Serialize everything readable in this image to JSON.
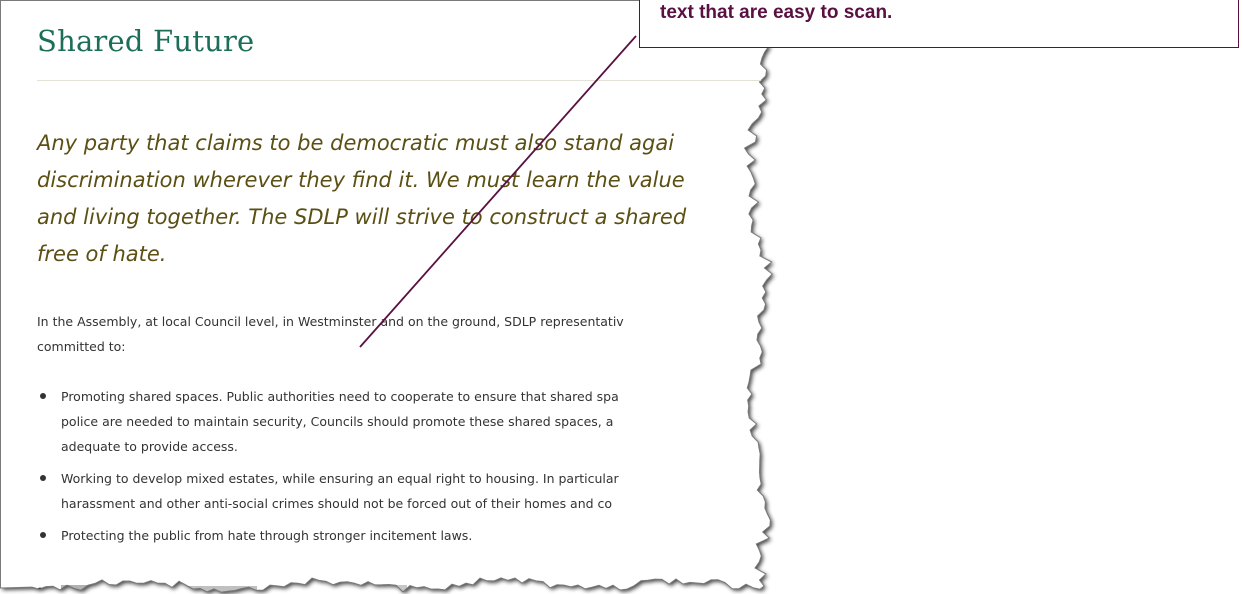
{
  "callout": {
    "text": "text that are easy to scan."
  },
  "article": {
    "title": "Shared Future",
    "intro_lines": [
      "Any party that claims to be democratic must also stand agai",
      "discrimination wherever they find it. We must learn the value",
      "and living together. The SDLP will strive to construct a shared",
      "free of hate."
    ],
    "lead_lines": [
      "In the Assembly, at local Council level, in Westminster and on the ground, SDLP representativ",
      "committed to:"
    ],
    "bullets": [
      {
        "lines": [
          "Promoting shared spaces. Public authorities need to cooperate to ensure that shared spa",
          "police are needed to maintain security, Councils should promote these shared spaces, a",
          "adequate to provide access."
        ]
      },
      {
        "lines": [
          "Working to develop mixed estates, while ensuring an equal right to housing. In particular",
          "harassment and other anti-social crimes should not be forced out of their homes and co"
        ]
      },
      {
        "lines": [
          "Protecting the public from hate through stronger incitement laws."
        ]
      }
    ]
  },
  "colors": {
    "title": "#1d6e58",
    "intro": "#5b4f14",
    "body_text": "#333333",
    "callout": "#5a1040"
  }
}
